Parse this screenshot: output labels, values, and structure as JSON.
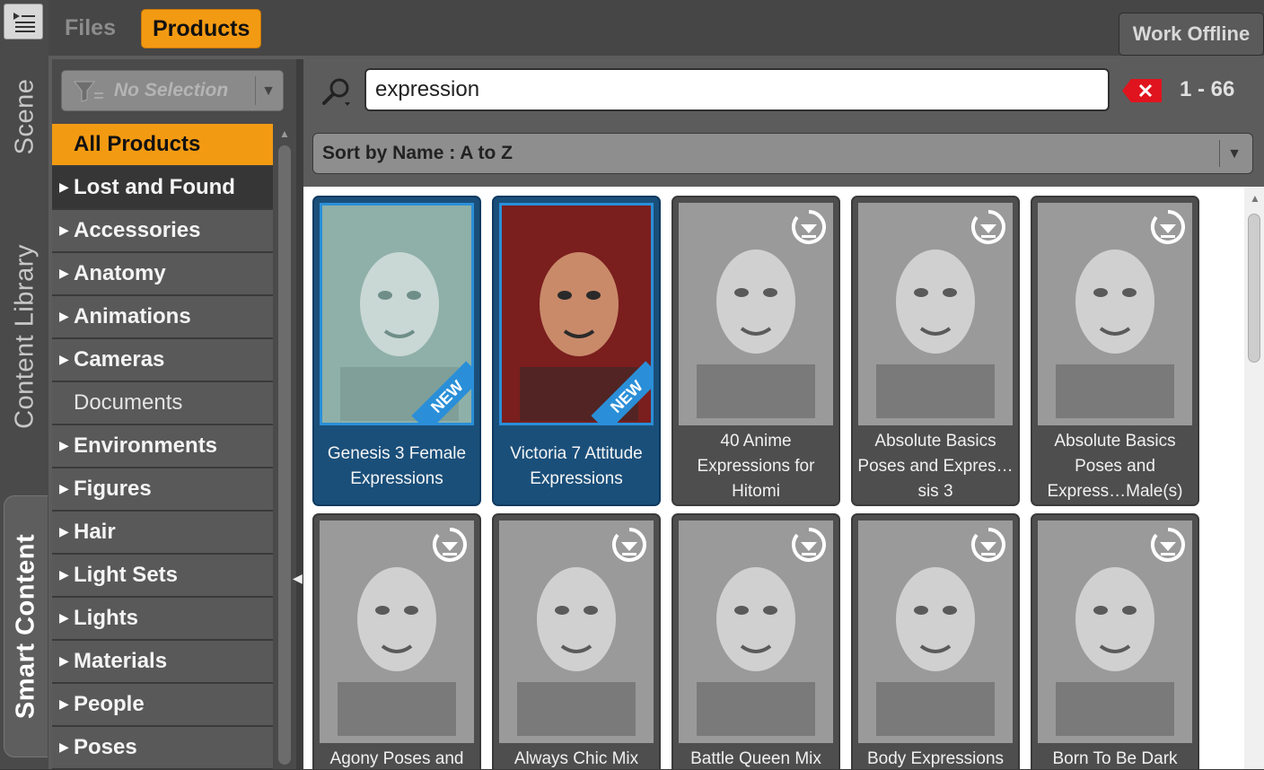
{
  "vertical_tabs": [
    {
      "label": "Scene",
      "active": false
    },
    {
      "label": "Content Library",
      "active": false
    },
    {
      "label": "Smart Content",
      "active": true
    }
  ],
  "top_tabs": [
    {
      "label": "Files",
      "active": false
    },
    {
      "label": "Products",
      "active": true
    }
  ],
  "toolbar": {
    "work_offline_label": "Work Offline"
  },
  "filter": {
    "label": "No Selection",
    "icon": "filter-icon"
  },
  "categories": [
    {
      "label": "All Products",
      "expandable": false,
      "state": "selected"
    },
    {
      "label": "Lost and Found",
      "expandable": true,
      "state": "dark"
    },
    {
      "label": "Accessories",
      "expandable": true,
      "state": "normal"
    },
    {
      "label": "Anatomy",
      "expandable": true,
      "state": "normal"
    },
    {
      "label": "Animations",
      "expandable": true,
      "state": "normal"
    },
    {
      "label": "Cameras",
      "expandable": true,
      "state": "normal"
    },
    {
      "label": "Documents",
      "expandable": false,
      "state": "plain"
    },
    {
      "label": "Environments",
      "expandable": true,
      "state": "normal"
    },
    {
      "label": "Figures",
      "expandable": true,
      "state": "normal"
    },
    {
      "label": "Hair",
      "expandable": true,
      "state": "normal"
    },
    {
      "label": "Light Sets",
      "expandable": true,
      "state": "normal"
    },
    {
      "label": "Lights",
      "expandable": true,
      "state": "normal"
    },
    {
      "label": "Materials",
      "expandable": true,
      "state": "normal"
    },
    {
      "label": "People",
      "expandable": true,
      "state": "normal"
    },
    {
      "label": "Poses",
      "expandable": true,
      "state": "normal"
    }
  ],
  "search": {
    "value": "expression",
    "result_count": "1 - 66",
    "clear_icon": "clear-x-icon"
  },
  "sort": {
    "label": "Sort by Name : A to Z"
  },
  "products": [
    {
      "title": "Genesis 3 Female Expressions",
      "installed": true,
      "new": true,
      "new_label": "NEW"
    },
    {
      "title": "Victoria 7 Attitude Expressions",
      "installed": true,
      "new": true,
      "new_label": "NEW"
    },
    {
      "title": "40 Anime Expressions for Hitomi",
      "installed": false,
      "new": false
    },
    {
      "title": "Absolute Basics Poses and Expres…sis 3",
      "installed": false,
      "new": false
    },
    {
      "title": "Absolute Basics Poses and Express…Male(s)",
      "installed": false,
      "new": false
    },
    {
      "title": "Agony Poses and",
      "installed": false,
      "new": false
    },
    {
      "title": "Always Chic Mix",
      "installed": false,
      "new": false
    },
    {
      "title": "Battle Queen Mix",
      "installed": false,
      "new": false
    },
    {
      "title": "Body Expressions",
      "installed": false,
      "new": false
    },
    {
      "title": "Born To Be Dark",
      "installed": false,
      "new": false
    }
  ],
  "colors": {
    "accent": "#f39a13",
    "installed_border": "#2a8fd8",
    "panel": "#5c5c5c"
  }
}
